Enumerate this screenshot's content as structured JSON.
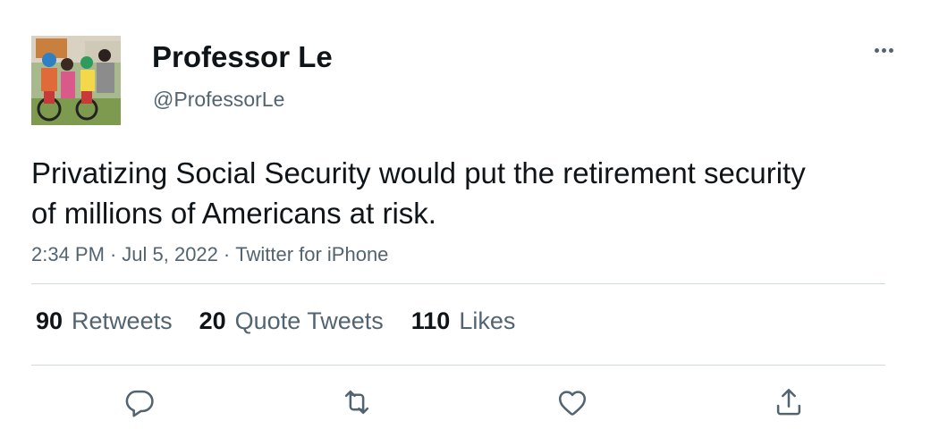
{
  "author": {
    "display_name": "Professor Le",
    "handle": "@ProfessorLe",
    "avatar_icon": "family-photo-avatar"
  },
  "tweet": {
    "text": "Privatizing Social Security would put the retirement security of millions of Americans at risk.",
    "time": "2:34 PM",
    "date": "Jul 5, 2022",
    "source": "Twitter for iPhone",
    "separator": "·"
  },
  "stats": {
    "retweets": {
      "count": "90",
      "label": "Retweets"
    },
    "quote_tweets": {
      "count": "20",
      "label": "Quote Tweets"
    },
    "likes": {
      "count": "110",
      "label": "Likes"
    }
  },
  "actions": [
    {
      "name": "reply",
      "icon": "reply-icon"
    },
    {
      "name": "retweet",
      "icon": "retweet-icon"
    },
    {
      "name": "like",
      "icon": "heart-icon"
    },
    {
      "name": "share",
      "icon": "share-icon"
    }
  ],
  "colors": {
    "text_primary": "#0f1419",
    "text_secondary": "#536471",
    "divider": "#cfd9de",
    "icon": "#536471"
  }
}
